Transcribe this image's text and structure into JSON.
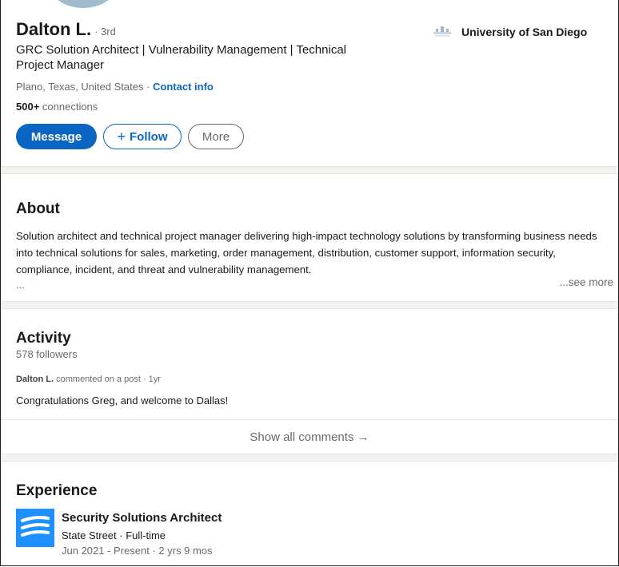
{
  "profile": {
    "name": "Dalton L.",
    "degree": "· 3rd",
    "headline": "GRC Solution Architect | Vulnerability Management | Technical Project Manager",
    "location": "Plano, Texas, United States · ",
    "contact_info": "Contact info",
    "connections_count": "500+",
    "connections_label": " connections",
    "education": "University of San Diego"
  },
  "actions": {
    "message": "Message",
    "follow": "Follow",
    "follow_icon": "+",
    "more": "More"
  },
  "about": {
    "title": "About",
    "text": "Solution architect and technical project manager delivering high-impact technology solutions by transforming business needs into technical solutions for sales, marketing, order management, distribution, customer support, information security, compliance, incident, and threat and vulnerability management.",
    "ellipsis": "...",
    "see_more": "...see more"
  },
  "activity": {
    "title": "Activity",
    "followers": "578 followers",
    "commenter_name": "Dalton L.",
    "commenter_action": " commented on a post · 1yr",
    "comment": "Congratulations Greg, and welcome to Dallas!",
    "show_all": "Show all comments →"
  },
  "experience": {
    "title": "Experience",
    "items": [
      {
        "title": "Security Solutions Architect",
        "company": "State Street · Full-time",
        "dates": "Jun 2021 - Present · 2 yrs 9 mos",
        "logo_icon": "state-street-logo-icon"
      }
    ]
  },
  "colors": {
    "brand_blue": "#0a66c2",
    "logo_blue": "#1e90ff",
    "divider": "#f3f2ef"
  }
}
